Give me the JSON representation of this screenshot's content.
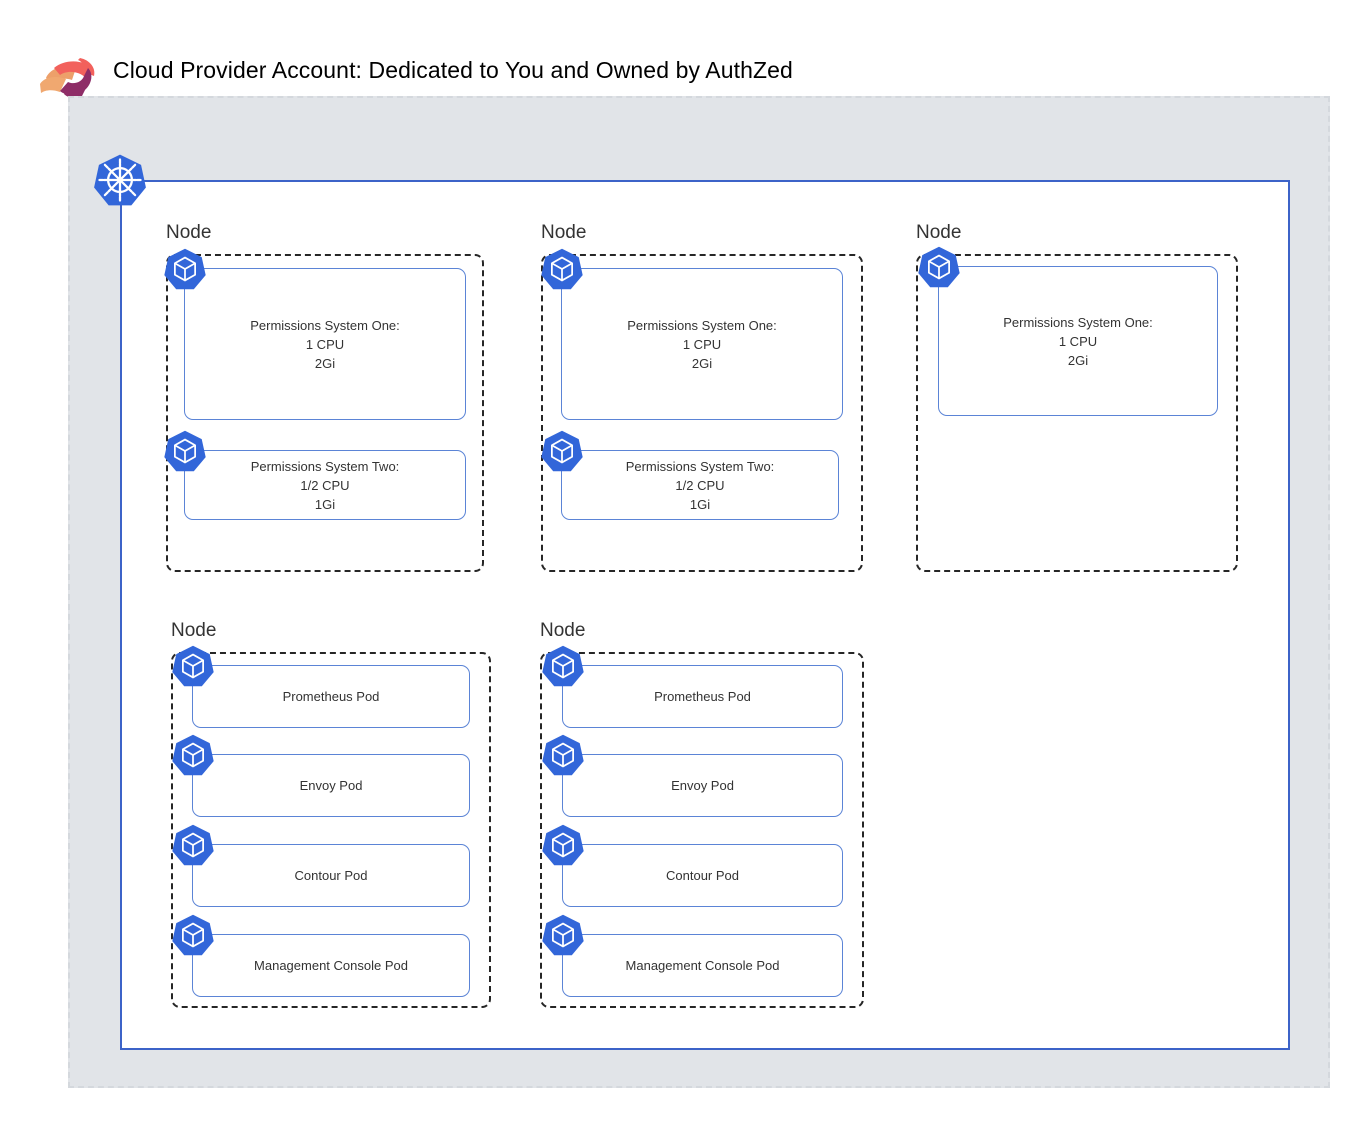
{
  "header": {
    "title": "Cloud Provider Account: Dedicated to You and Owned by AuthZed",
    "logo_icon": "authzed-logo-icon"
  },
  "cluster": {
    "icon": "kubernetes-icon",
    "accent_border_color": "#3c63c8",
    "background_color": "#e1e4e8"
  },
  "node_label": "Node",
  "pod_icon": "kubernetes-pod-icon",
  "nodes": [
    {
      "label": "Node",
      "pods": [
        {
          "label": "Permissions System One:\n1 CPU\n2Gi"
        },
        {
          "label": "Permissions System Two:\n1/2 CPU\n1Gi"
        }
      ]
    },
    {
      "label": "Node",
      "pods": [
        {
          "label": "Permissions System One:\n1 CPU\n2Gi"
        },
        {
          "label": "Permissions System Two:\n1/2 CPU\n1Gi"
        }
      ]
    },
    {
      "label": "Node",
      "pods": [
        {
          "label": "Permissions System One:\n1 CPU\n2Gi"
        }
      ]
    },
    {
      "label": "Node",
      "pods": [
        {
          "label": "Prometheus Pod"
        },
        {
          "label": "Envoy Pod"
        },
        {
          "label": "Contour Pod"
        },
        {
          "label": "Management Console Pod"
        }
      ]
    },
    {
      "label": "Node",
      "pods": [
        {
          "label": "Prometheus Pod"
        },
        {
          "label": "Envoy Pod"
        },
        {
          "label": "Contour Pod"
        },
        {
          "label": "Management Console Pod"
        }
      ]
    }
  ]
}
